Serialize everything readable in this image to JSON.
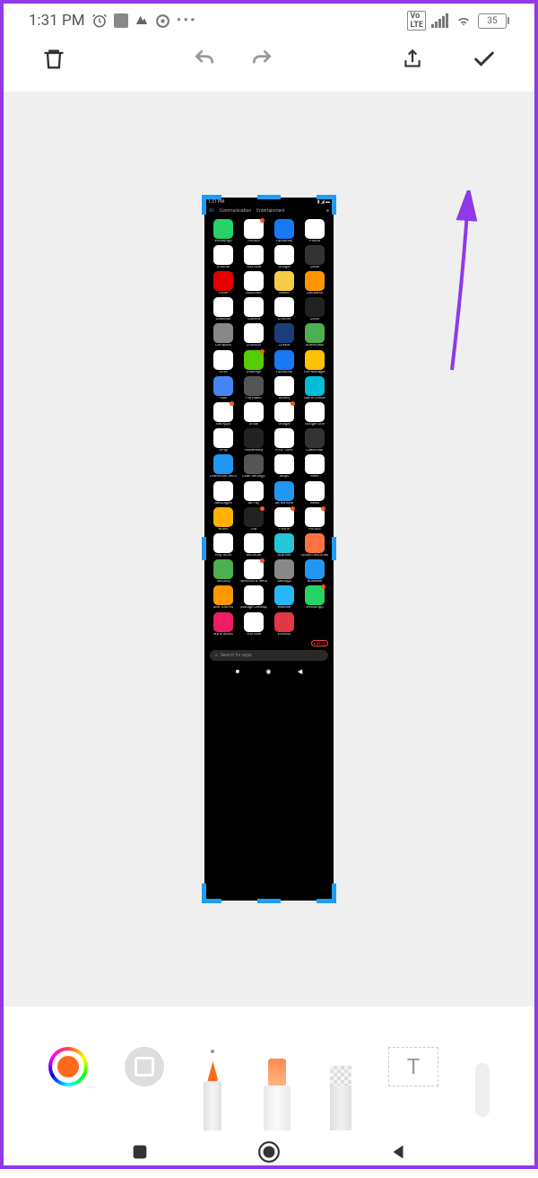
{
  "status": {
    "time": "1:31 PM",
    "battery": "35"
  },
  "toolbar": {
    "delete": "Delete",
    "undo": "Undo",
    "redo": "Redo",
    "share": "Share",
    "done": "Done"
  },
  "screenshot": {
    "status_time": "1:31 PM",
    "tabs": [
      "All",
      "Communication",
      "Entertainment"
    ],
    "search": "Search for apps",
    "apps": [
      {
        "n": "WhatsApp",
        "c": "#25d366",
        "b": 0
      },
      {
        "n": "Photos",
        "c": "#fff",
        "b": 1
      },
      {
        "n": "Facebook",
        "c": "#1877f2",
        "b": 0
      },
      {
        "n": "Phone",
        "c": "#fff",
        "b": 0
      },
      {
        "n": "Chrome",
        "c": "#fff",
        "b": 0
      },
      {
        "n": "YouTube",
        "c": "#fff",
        "b": 0
      },
      {
        "n": "Google",
        "c": "#fff",
        "b": 0
      },
      {
        "n": "Clock",
        "c": "#333",
        "b": 0
      },
      {
        "n": "Airtel",
        "c": "#e40000",
        "b": 0
      },
      {
        "n": "Assistant",
        "c": "#fff",
        "b": 0
      },
      {
        "n": "Blinkit",
        "c": "#f8cb46",
        "b": 0
      },
      {
        "n": "Calculator",
        "c": "#ff9500",
        "b": 0
      },
      {
        "n": "Calendar",
        "c": "#fff",
        "b": 0
      },
      {
        "n": "Camera",
        "c": "#fff",
        "b": 0
      },
      {
        "n": "Chrome",
        "c": "#fff",
        "b": 0
      },
      {
        "n": "Clock",
        "c": "#222",
        "b": 0
      },
      {
        "n": "Compass",
        "c": "#888",
        "b": 0
      },
      {
        "n": "Contacts",
        "c": "#fff",
        "b": 0
      },
      {
        "n": "CoWIN",
        "c": "#1a3d7c",
        "b": 0
      },
      {
        "n": "Downloads",
        "c": "#4caf50",
        "b": 0
      },
      {
        "n": "Drive",
        "c": "#fff",
        "b": 0
      },
      {
        "n": "Duolingo",
        "c": "#58cc02",
        "b": 1
      },
      {
        "n": "Facebook",
        "c": "#1877f2",
        "b": 0
      },
      {
        "n": "File Manager",
        "c": "#ffc107",
        "b": 0
      },
      {
        "n": "Files",
        "c": "#4285f4",
        "b": 0
      },
      {
        "n": "FM Radio",
        "c": "#555",
        "b": 0
      },
      {
        "n": "Gallery",
        "c": "#fff",
        "b": 0
      },
      {
        "n": "Game Center",
        "c": "#00bcd4",
        "b": 0
      },
      {
        "n": "GetApps",
        "c": "#fff",
        "b": 1
      },
      {
        "n": "Gmail",
        "c": "#fff",
        "b": 0
      },
      {
        "n": "Google",
        "c": "#fff",
        "b": 1
      },
      {
        "n": "Google One",
        "c": "#fff",
        "b": 0
      },
      {
        "n": "GPay",
        "c": "#fff",
        "b": 0
      },
      {
        "n": "HeyMelody",
        "c": "#222",
        "b": 0
      },
      {
        "n": "KVB - Dlite",
        "c": "#fff",
        "b": 0
      },
      {
        "n": "Lawnchair",
        "c": "#333",
        "b": 0
      },
      {
        "n": "Lawnchair Settings",
        "c": "#2196f3",
        "b": 0
      },
      {
        "n": "Lean Settings",
        "c": "#555",
        "b": 0
      },
      {
        "n": "Maps",
        "c": "#fff",
        "b": 0
      },
      {
        "n": "Meet",
        "c": "#fff",
        "b": 0
      },
      {
        "n": "Messages",
        "c": "#fff",
        "b": 0
      },
      {
        "n": "Mi Pay",
        "c": "#fff",
        "b": 0
      },
      {
        "n": "Mi Remote",
        "c": "#2196f3",
        "b": 0
      },
      {
        "n": "News",
        "c": "#fff",
        "b": 0
      },
      {
        "n": "Notes",
        "c": "#ffb300",
        "b": 0
      },
      {
        "n": "Ola",
        "c": "#222",
        "b": 1
      },
      {
        "n": "Phone",
        "c": "#fff",
        "b": 1
      },
      {
        "n": "Photos",
        "c": "#fff",
        "b": 1
      },
      {
        "n": "Play Store",
        "c": "#fff",
        "b": 0
      },
      {
        "n": "Recorder",
        "c": "#fff",
        "b": 0
      },
      {
        "n": "Scanner",
        "c": "#26c6da",
        "b": 0
      },
      {
        "n": "Screen Recorder",
        "c": "#ff7043",
        "b": 0
      },
      {
        "n": "Security",
        "c": "#4caf50",
        "b": 0
      },
      {
        "n": "Services & feedback",
        "c": "#fff",
        "b": 1
      },
      {
        "n": "Settings",
        "c": "#888",
        "b": 0
      },
      {
        "n": "ShareMe",
        "c": "#2196f3",
        "b": 0
      },
      {
        "n": "SIM Tool Kit",
        "c": "#ff9800",
        "b": 0
      },
      {
        "n": "Storage Cleanup",
        "c": "#fff",
        "b": 0
      },
      {
        "n": "Weather",
        "c": "#29b6f6",
        "b": 0
      },
      {
        "n": "WhatsApp",
        "c": "#25d366",
        "b": 1
      },
      {
        "n": "Wynk Music",
        "c": "#e91e63",
        "b": 0
      },
      {
        "n": "YouTube",
        "c": "#fff",
        "b": 0
      },
      {
        "n": "Zomato",
        "c": "#e23744",
        "b": 0
      }
    ],
    "rec_time": "00:10"
  },
  "tools": {
    "text": "T"
  }
}
